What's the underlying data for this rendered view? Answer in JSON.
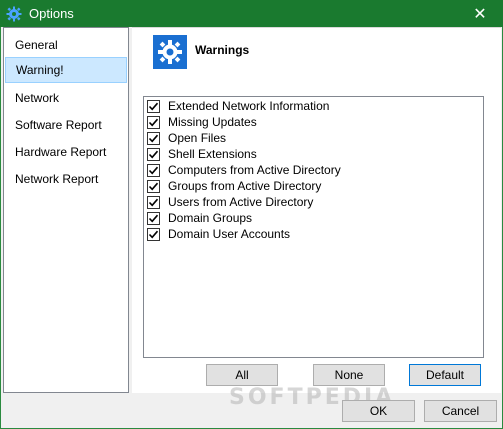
{
  "window": {
    "title": "Options",
    "close_glyph": "✕"
  },
  "sidebar": {
    "items": [
      {
        "label": "General"
      },
      {
        "label": "Warning!"
      },
      {
        "label": "Network"
      },
      {
        "label": "Software Report"
      },
      {
        "label": "Hardware Report"
      },
      {
        "label": "Network Report"
      }
    ],
    "selected_index": 1
  },
  "content": {
    "header_title": "Warnings",
    "header_icon": "gear-icon",
    "checks": [
      {
        "label": "Extended Network Information",
        "checked": true
      },
      {
        "label": "Missing Updates",
        "checked": true
      },
      {
        "label": "Open Files",
        "checked": true
      },
      {
        "label": "Shell Extensions",
        "checked": true
      },
      {
        "label": "Computers from Active Directory",
        "checked": true
      },
      {
        "label": "Groups from Active Directory",
        "checked": true
      },
      {
        "label": "Users from Active Directory",
        "checked": true
      },
      {
        "label": "Domain Groups",
        "checked": true
      },
      {
        "label": "Domain User Accounts",
        "checked": true
      }
    ],
    "buttons": {
      "all": "All",
      "none": "None",
      "default": "Default"
    }
  },
  "footer": {
    "ok": "OK",
    "cancel": "Cancel"
  },
  "watermark": "SOFTPEDIA",
  "colors": {
    "titlebar": "#1a7a2f",
    "accent_icon": "#1a6fd1",
    "selection": "#cce8ff"
  }
}
